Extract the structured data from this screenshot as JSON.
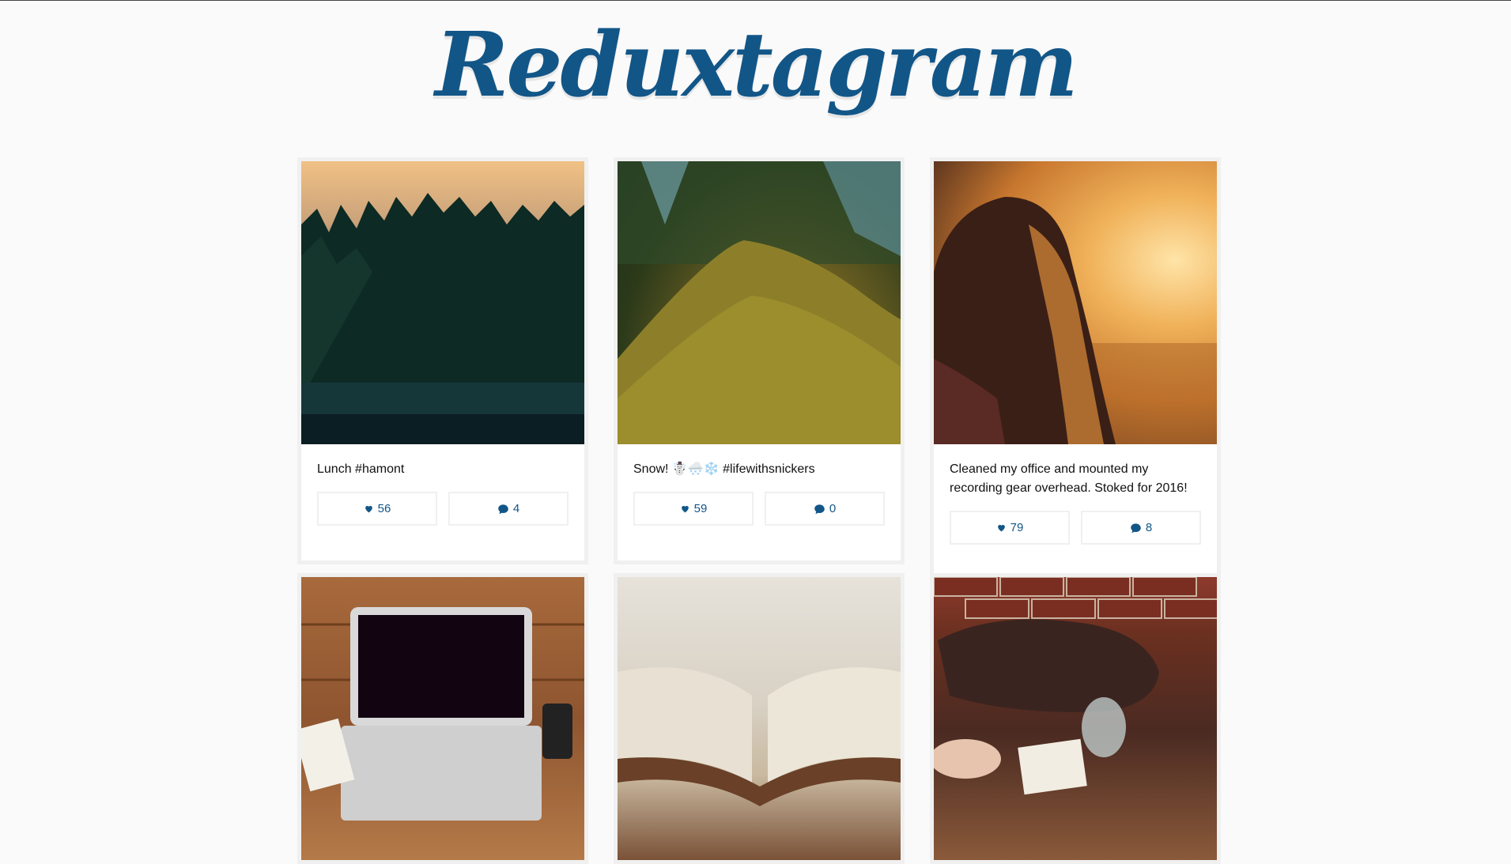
{
  "app": {
    "title": "Reduxtagram"
  },
  "posts": [
    {
      "caption": "Lunch #hamont",
      "likes": "56",
      "comments": "4",
      "photo": "forest-photo"
    },
    {
      "caption": "Snow! ☃️🌨️❄️ #lifewithsnickers",
      "likes": "59",
      "comments": "0",
      "photo": "moss-log-photo"
    },
    {
      "caption": "Cleaned my office and mounted my recording gear overhead. Stoked for 2016!",
      "likes": "79",
      "comments": "8",
      "photo": "sunset-girl-photo"
    },
    {
      "caption": "",
      "likes": "",
      "comments": "",
      "photo": "laptop-photo"
    },
    {
      "caption": "",
      "likes": "",
      "comments": "",
      "photo": "book-photo"
    },
    {
      "caption": "",
      "likes": "",
      "comments": "",
      "photo": "bag-photo"
    }
  ],
  "icons": {
    "like": "heart-icon",
    "comment": "speech-bubble-icon"
  },
  "colors": {
    "brand": "#125688",
    "background": "#fafafa",
    "card_border": "#f0f0f0"
  }
}
